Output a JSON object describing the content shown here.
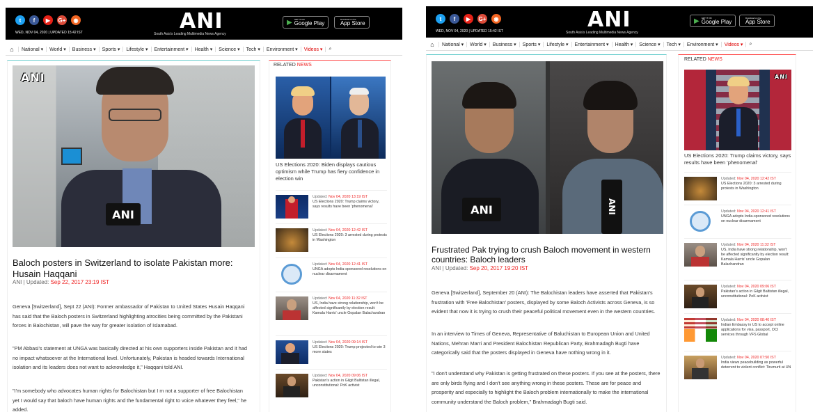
{
  "common": {
    "social_icons": [
      "twitter-icon",
      "facebook-icon",
      "youtube-icon",
      "google-plus-icon",
      "rss-icon"
    ],
    "logo": "ANI",
    "tagline": "South Asia's Leading Multimedia News Agency",
    "google_play": {
      "small": "GET IT ON",
      "big": "Google Play"
    },
    "app_store": {
      "small": "Download on the",
      "big": "App Store"
    },
    "nav": [
      "National",
      "World",
      "Business",
      "Sports",
      "Lifestyle",
      "Entertainment",
      "Health",
      "Science",
      "Tech",
      "Environment",
      "Videos"
    ],
    "related_label": "RELATED",
    "related_accent": "NEWS",
    "updated_prefix": "Updated:",
    "colors": {
      "accent_red": "#e22222",
      "header_bg": "#000000",
      "nav_top": "#66cccc"
    }
  },
  "left": {
    "date": "WED, NOV 04, 2020 | UPDATED 15:42 IST",
    "watermark": "ANI",
    "mic_label": "ANI",
    "headline": "Baloch posters in Switzerland to isolate Pakistan more: Husain Haqqani",
    "meta_prefix": "ANI | Updated:",
    "meta_date": "Sep 22, 2017 23:19 IST",
    "paragraphs": [
      "Geneva [Switzerland], Sept 22 (ANI): Former ambassador of Pakistan to United States Husain Haqqani has said that the Baloch posters in Switzerland highlighting atrocities being committed by the Pakistani forces in Balochistan, will pave the way for greater isolation of Islamabad.",
      "\"PM Abbasi's statement at UNGA was basically directed at his own supporters inside Pakistan and it had no impact whatsoever at the International level. Unfortunately, Pakistan is headed towards International isolation and its leaders does not want to acknowledge it,\" Haqqani told ANI.",
      "\"I'm somebody who advocates human rights for Balochistan but I m not a supporter of free Balochistan yet I would say that baloch have human rights and the fundamental right to voice whatever they feel,\" he added."
    ],
    "featured_caption": "US Elections 2020: Biden displays cautious optimism while Trump has fiery confidence in election win",
    "side_items": [
      {
        "date": "Nov 04, 2020 13:19 IST",
        "title": "US Elections 2020: Trump claims victory, says results have been 'phenomenal'"
      },
      {
        "date": "Nov 04, 2020 12:42 IST",
        "title": "US Elections 2020: 3 arrested during protests in Washington"
      },
      {
        "date": "Nov 04, 2020 12:41 IST",
        "title": "UNGA adopts India-sponsored resolutions on nuclear disarmament"
      },
      {
        "date": "Nov 04, 2020 11:32 IST",
        "title": "US, India have strong relationship, won't be affected significantly by election result: Kamala Harris' uncle Gopalan Balachandran"
      },
      {
        "date": "Nov 04, 2020 09:14 IST",
        "title": "US Elections 2020: Trump projected to win 3 more states"
      },
      {
        "date": "Nov 04, 2020 09:06 IST",
        "title": "Pakistan's action in Gilgit Baltistan illegal, unconstitutional: PoK activist"
      }
    ]
  },
  "right": {
    "date": "WED, NOV 04, 2020 | UPDATED 15:42 IST",
    "mic_label": "ANI",
    "headline": "Frustrated Pak trying to crush Baloch movement in western countries: Baloch leaders",
    "meta_prefix": "ANI | Updated:",
    "meta_date": "Sep 20, 2017 19:20 IST",
    "paragraphs": [
      "Geneva [Switzerland], September 20 (ANI): The Balochistan leaders have asserted that Pakistan's frustration with 'Free Balochistan' posters, displayed by some Baloch Activists across Geneva, is so evident that now it is trying to crush their peaceful political movement even in the western countries.",
      "In an interview to Times of Geneva, Representative of Baluchistan to European Union and United Nations, Mehran Marri and President Balochistan Republican Party, Brahmadagh Bugti have categorically said that the posters displayed in Geneva have nothing wrong in it.",
      "\"I don't understand why Pakistan is getting frustrated on these posters. If you see at the posters, there are only birds flying and I don't see anything wrong in these posters. These are for peace and prosperity and especially to highlight the Baloch problem internationally to make the international community understand the Baloch problem,\" Brahmadagh Bugti said."
    ],
    "featured_watermark": "ANI",
    "featured_caption": "US Elections 2020: Trump claims victory, says results have been 'phenomenal'",
    "side_items": [
      {
        "date": "Nov 04, 2020 12:42 IST",
        "title": "US Elections 2020: 3 arrested during protests in Washington"
      },
      {
        "date": "Nov 04, 2020 12:41 IST",
        "title": "UNGA adopts India-sponsored resolutions on nuclear disarmament"
      },
      {
        "date": "Nov 04, 2020 11:32 IST",
        "title": "US, India have strong relationship, won't be affected significantly by election result: Kamala Harris' uncle Gopalan Balachandran"
      },
      {
        "date": "Nov 04, 2020 09:06 IST",
        "title": "Pakistan's action in Gilgit Baltistan illegal, unconstitutional: PoK activist"
      },
      {
        "date": "Nov 04, 2020 08:40 IST",
        "title": "Indian Embassy in US to accept online applications for visa, passport, OCI services through VFS Global"
      },
      {
        "date": "Nov 04, 2020 07:50 IST",
        "title": "India views peacebuilding as powerful deterrent to violent conflict: Tirumurti at UN"
      }
    ]
  }
}
